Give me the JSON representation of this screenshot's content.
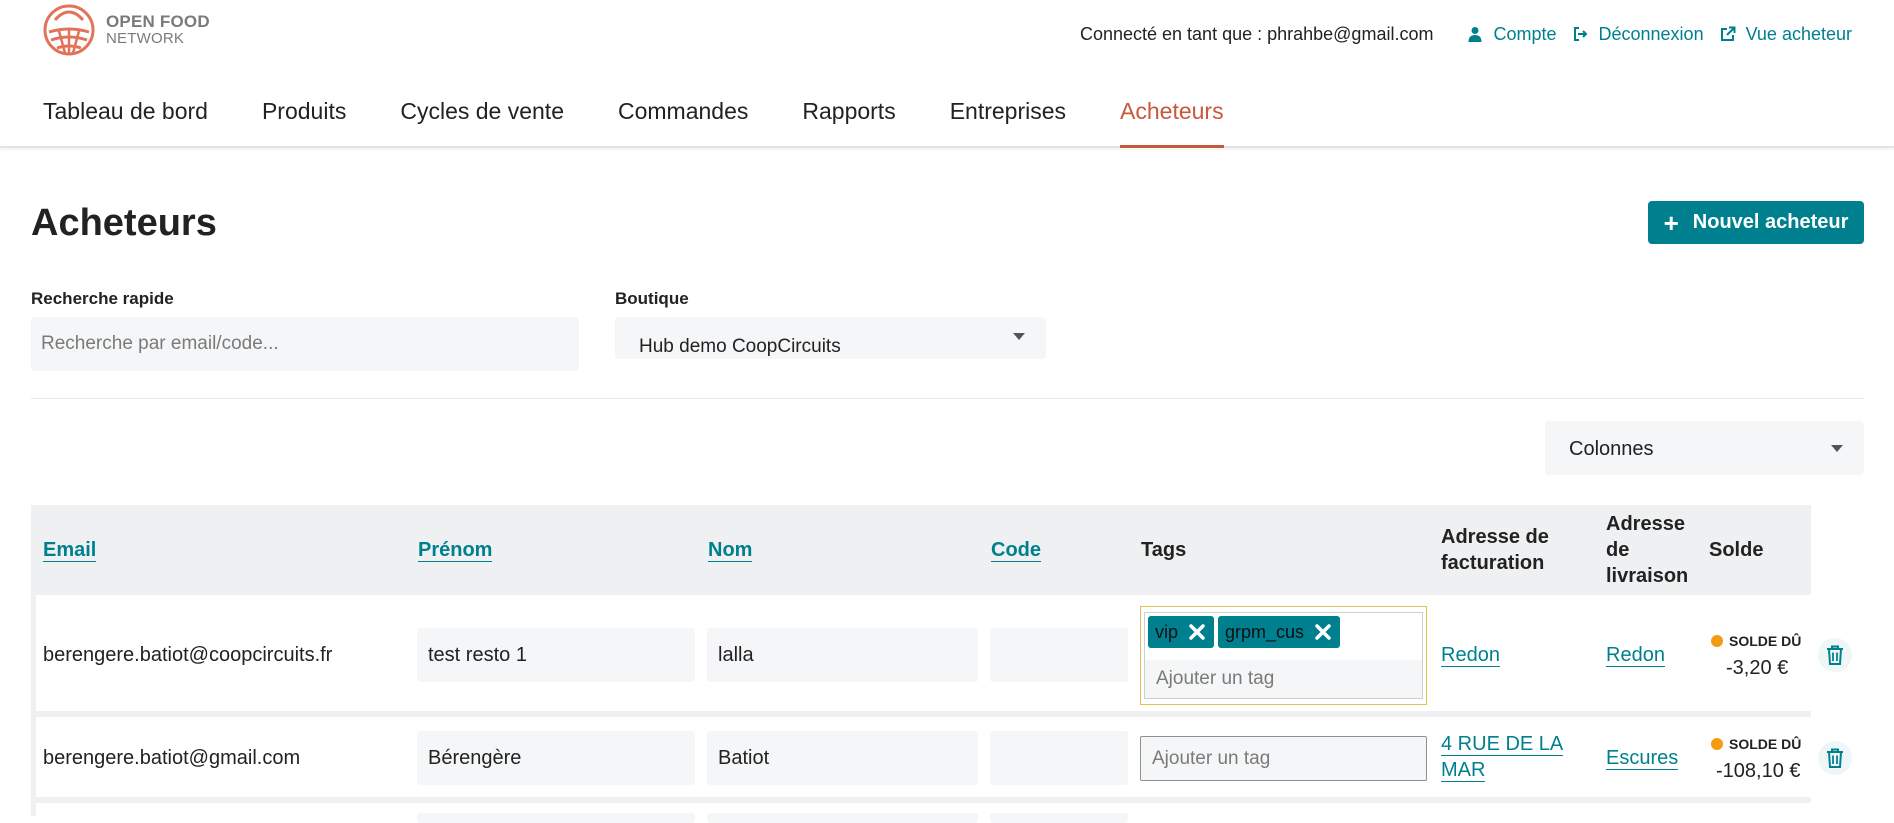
{
  "app": {
    "logo_line1": "OPEN FOOD",
    "logo_line2": "NETWORK",
    "accent_color": "#00808f",
    "active_color": "#c9573c",
    "warning_color": "#f39c12"
  },
  "userbar": {
    "connected_as": "Connecté en tant que : phrahbe@gmail.com",
    "account": "Compte",
    "logout": "Déconnexion",
    "buyer_view": "Vue acheteur"
  },
  "nav": {
    "items": [
      {
        "label": "Tableau de bord",
        "active": false
      },
      {
        "label": "Produits",
        "active": false
      },
      {
        "label": "Cycles de vente",
        "active": false
      },
      {
        "label": "Commandes",
        "active": false
      },
      {
        "label": "Rapports",
        "active": false
      },
      {
        "label": "Entreprises",
        "active": false
      },
      {
        "label": "Acheteurs",
        "active": true
      }
    ]
  },
  "page": {
    "title": "Acheteurs",
    "new_button": "Nouvel acheteur"
  },
  "filters": {
    "search_label": "Recherche rapide",
    "search_placeholder": "Recherche par email/code...",
    "shop_label": "Boutique",
    "shop_value": "Hub demo CoopCircuits",
    "columns_label": "Colonnes"
  },
  "table": {
    "headers": {
      "email": "Email",
      "firstname": "Prénom",
      "lastname": "Nom",
      "code": "Code",
      "tags": "Tags",
      "billing_l1": "Adresse de",
      "billing_l2": "facturation",
      "shipping_l1": "Adresse",
      "shipping_l2": "de",
      "shipping_l3": "livraison",
      "balance": "Solde"
    },
    "tag_placeholder": "Ajouter un tag",
    "rows": [
      {
        "email": "berengere.batiot@coopcircuits.fr",
        "firstname": "test resto 1",
        "lastname": "lalla",
        "code": "",
        "tags": [
          "vip",
          "grpm_cus"
        ],
        "billing_l1": "Redon",
        "billing_l2": "",
        "shipping": "Redon",
        "balance_status": "SOLDE DÛ",
        "balance_value": "-3,20 €"
      },
      {
        "email": "berengere.batiot@gmail.com",
        "firstname": "Bérengère",
        "lastname": "Batiot",
        "code": "",
        "tags": [],
        "billing_l1": "4 RUE DE LA",
        "billing_l2": "MAR",
        "shipping": "Escures",
        "balance_status": "SOLDE DÛ",
        "balance_value": "-108,10 €"
      }
    ]
  }
}
